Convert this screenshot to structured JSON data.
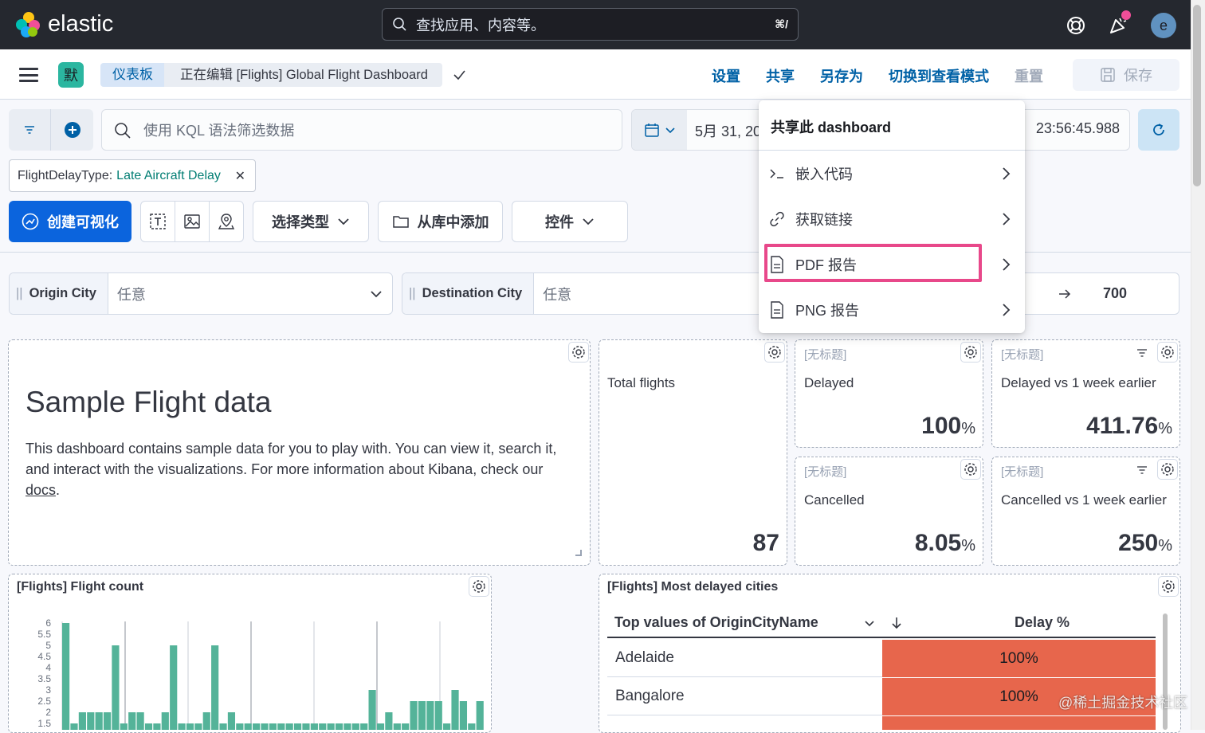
{
  "header": {
    "brand": "elastic",
    "search_placeholder": "查找应用、内容等。",
    "search_shortcut": "⌘/",
    "avatar_initial": "e"
  },
  "nav": {
    "space_initial": "默",
    "breadcrumb": [
      "仪表板",
      "正在编辑 [Flights] Global Flight Dashboard"
    ],
    "actions": [
      "设置",
      "共享",
      "另存为",
      "切换到查看模式",
      "重置"
    ],
    "save_label": "保存"
  },
  "query": {
    "kql_placeholder": "使用 KQL 语法筛选数据",
    "date_start": "5月 31, 20",
    "date_end": "23:56:45.988"
  },
  "filter_pill": {
    "key": "FlightDelayType:",
    "value": "Late Aircraft Delay"
  },
  "toolbar": {
    "create_label": "创建可视化",
    "select_type_label": "选择类型",
    "add_from_library_label": "从库中添加",
    "controls_label": "控件"
  },
  "controls": [
    {
      "label": "Origin City",
      "value": "任意"
    },
    {
      "label": "Destination City",
      "value": "任意"
    }
  ],
  "range_control": {
    "max": "700"
  },
  "share_menu": {
    "title": "共享此 dashboard",
    "items": [
      "嵌入代码",
      "获取链接",
      "PDF 报告",
      "PNG 报告"
    ]
  },
  "markdown": {
    "title": "Sample Flight data",
    "body_pre": "This dashboard contains sample data for you to play with. You can view it, search it, and interact with the visualizations. For more information about Kibana, check our ",
    "link": "docs",
    "body_post": "."
  },
  "metrics": [
    {
      "title": "",
      "label": "Total flights",
      "value": "87",
      "unit": ""
    },
    {
      "title": "[无标题]",
      "label": "Delayed",
      "value": "100",
      "unit": "%"
    },
    {
      "title": "[无标题]",
      "label": "Delayed vs 1 week earlier",
      "value": "411.76",
      "unit": "%"
    },
    {
      "title": "[无标题]",
      "label": "Cancelled",
      "value": "8.05",
      "unit": "%"
    },
    {
      "title": "[无标题]",
      "label": "Cancelled vs 1 week earlier",
      "value": "250",
      "unit": "%"
    }
  ],
  "flight_count_panel": {
    "title": "[Flights] Flight count"
  },
  "chart_data": {
    "type": "bar",
    "title": "[Flights] Flight count",
    "ylim": [
      1.5,
      6
    ],
    "yticks": [
      "6",
      "5.5",
      "5",
      "4.5",
      "4",
      "3.5",
      "3",
      "2.5",
      "2",
      "1.5"
    ],
    "values": [
      6,
      1.5,
      2,
      2,
      2,
      2,
      5,
      1.5,
      2,
      2,
      1.5,
      1.5,
      2,
      5,
      1.5,
      1.5,
      1.5,
      2,
      5,
      1.5,
      2,
      1.5,
      1.5,
      1.5,
      1.5,
      1.5,
      1.5,
      1.5,
      1.5,
      1.5,
      1.5,
      1.5,
      1.5,
      1.5,
      1.5,
      1.5,
      1.5,
      3,
      1.5,
      2,
      1.5,
      1.5,
      2.5,
      2.5,
      2.5,
      2.5,
      1.5,
      3,
      2.5,
      1.5,
      2.5
    ]
  },
  "delayed_cities": {
    "title": "[Flights] Most delayed cities",
    "col1": "Top values of OriginCityName",
    "col2": "Delay %",
    "rows": [
      {
        "city": "Adelaide",
        "pct": "100%"
      },
      {
        "city": "Bangalore",
        "pct": "100%"
      }
    ]
  },
  "watermark": "@稀土掘金技术社区",
  "colors": {
    "accent": "#0b64dd",
    "bar": "#54b399",
    "highlight": "#e8488a",
    "delay_cell": "#e7664c"
  }
}
